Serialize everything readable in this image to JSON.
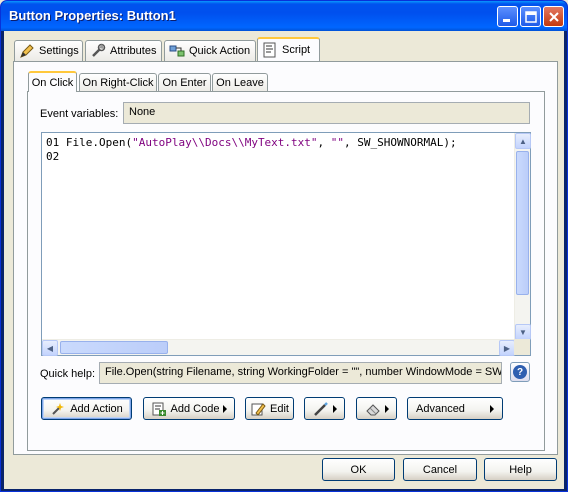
{
  "window": {
    "title": "Button Properties: Button1"
  },
  "tabs": [
    {
      "label": "Settings",
      "icon": "pencil-icon"
    },
    {
      "label": "Attributes",
      "icon": "wrench-icon"
    },
    {
      "label": "Quick Action",
      "icon": "quick-action-icon"
    },
    {
      "label": "Script",
      "icon": "script-icon",
      "active": true
    }
  ],
  "event_tabs": [
    {
      "label": "On Click",
      "active": true
    },
    {
      "label": "On Right-Click"
    },
    {
      "label": "On Enter"
    },
    {
      "label": "On Leave"
    }
  ],
  "event_variables": {
    "label": "Event variables:",
    "value": "None"
  },
  "script": {
    "line1_num": "01",
    "line1_pre": "File.Open(",
    "line1_str1": "\"AutoPlay\\\\Docs\\\\MyText.txt\"",
    "line1_mid": ", ",
    "line1_str2": "\"\"",
    "line1_post": ", SW_SHOWNORMAL);",
    "line2_num": "02"
  },
  "quick_help": {
    "label": "Quick help:",
    "value": "File.Open(string Filename, string WorkingFolder = \"\", number WindowMode = SW_"
  },
  "toolbar": {
    "add_action": "Add Action",
    "add_code": "Add Code",
    "edit": "Edit",
    "advanced": "Advanced"
  },
  "footer": {
    "ok": "OK",
    "cancel": "Cancel",
    "help": "Help"
  },
  "colors": {
    "titlebar": "#0053EE",
    "dialog_bg": "#ECE9D8",
    "string_literal": "#7F007F",
    "active_tab_accent": "#FFC83C"
  }
}
